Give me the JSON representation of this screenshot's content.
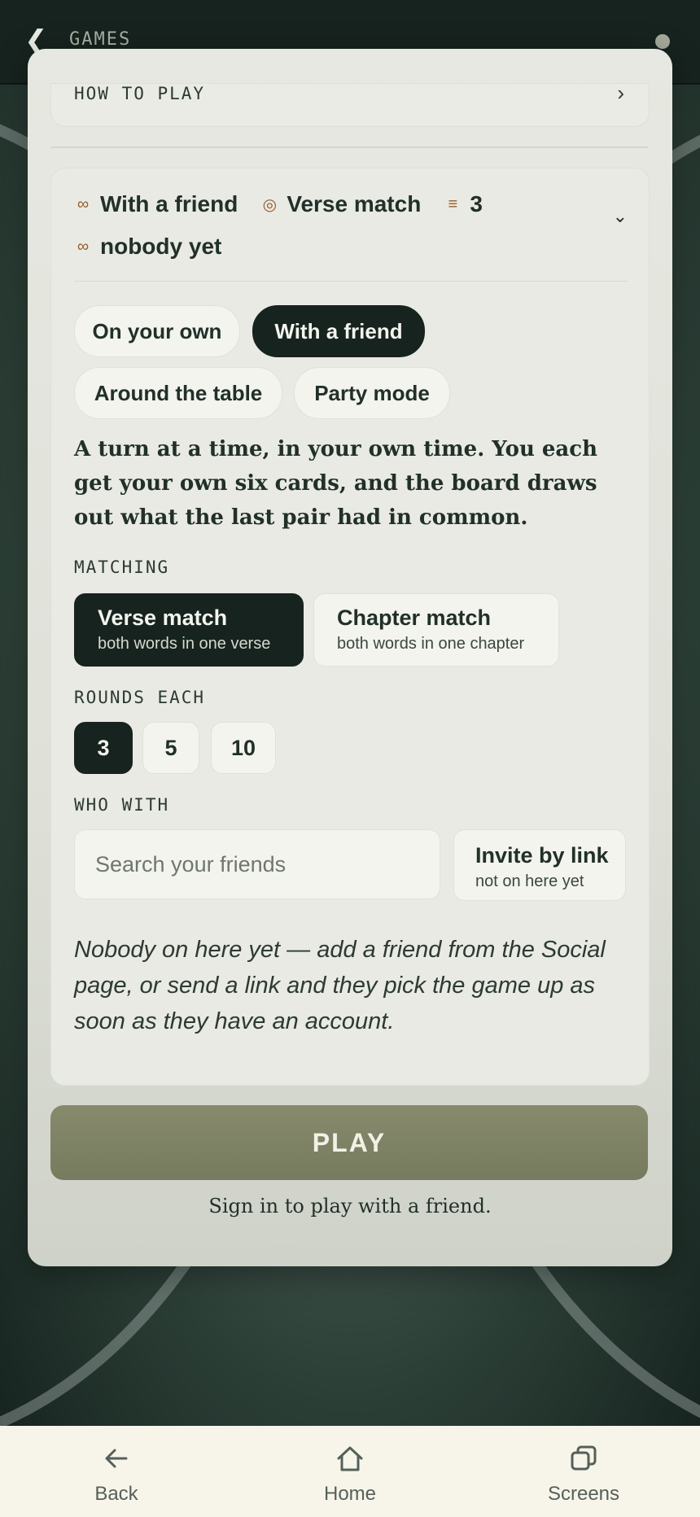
{
  "topbar": {
    "back_icon": "chevron-left-icon",
    "title": "GAMES"
  },
  "how_to_play": {
    "label": "HOW TO PLAY",
    "chevron": "›"
  },
  "summary": {
    "mode": "With a friend",
    "matching": "Verse match",
    "rounds": "3",
    "opponent": "nobody yet",
    "icons": {
      "mode": "link-icon",
      "matching": "target-icon",
      "rounds": "list-icon",
      "opponent": "link-icon"
    }
  },
  "modes": [
    {
      "label": "On your own",
      "selected": false
    },
    {
      "label": "With a friend",
      "selected": true
    },
    {
      "label": "Around the table",
      "selected": false
    },
    {
      "label": "Party mode",
      "selected": false
    }
  ],
  "mode_description": "A turn at a time, in your own time. You each get your own six cards, and the board draws out what the last pair had in common.",
  "matching": {
    "label": "MATCHING",
    "options": [
      {
        "title": "Verse match",
        "subtitle": "both words in one verse",
        "selected": true
      },
      {
        "title": "Chapter match",
        "subtitle": "both words in one chapter",
        "selected": false
      }
    ]
  },
  "rounds": {
    "label": "ROUNDS EACH",
    "options": [
      {
        "value": "3",
        "selected": true
      },
      {
        "value": "5",
        "selected": false
      },
      {
        "value": "10",
        "selected": false
      }
    ]
  },
  "who_with": {
    "label": "WHO WITH",
    "search_placeholder": "Search your friends",
    "search_value": "",
    "invite_title": "Invite by link",
    "invite_subtitle": "not on here yet"
  },
  "empty_note": "Nobody on here yet — add a friend from the Social page, or send a link and they pick the game up as soon as they have an account.",
  "play_label": "PLAY",
  "signin_note": "Sign in to play with a friend.",
  "bottom_nav": {
    "back": "Back",
    "home": "Home",
    "screens": "Screens"
  },
  "colors": {
    "dark": "#17231f",
    "play": "#7f8365",
    "accent_icon": "#9b5a2a"
  }
}
